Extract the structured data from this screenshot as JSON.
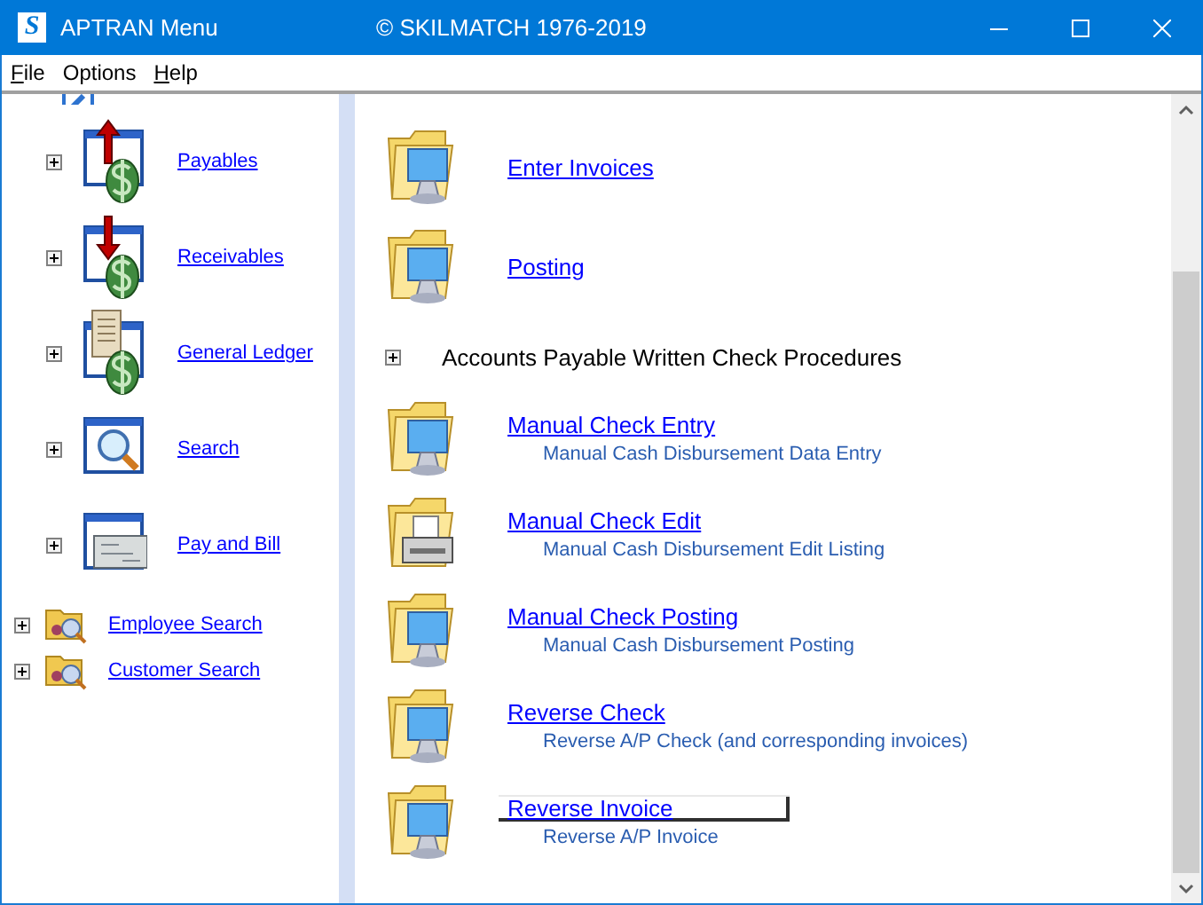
{
  "window": {
    "logo": "S",
    "title": "APTRAN Menu",
    "copyright": "© SKILMATCH 1976-2019"
  },
  "menu": [
    {
      "label": "File",
      "mnemonic": true
    },
    {
      "label": "Options",
      "mnemonic": false
    },
    {
      "label": "Help",
      "mnemonic": true
    }
  ],
  "sidebar": {
    "items": [
      {
        "kind": "large",
        "label": "Payables",
        "expanded": false
      },
      {
        "kind": "large",
        "label": "Receivables",
        "expanded": false
      },
      {
        "kind": "large",
        "label": "General Ledger",
        "expanded": false
      },
      {
        "kind": "large",
        "label": "Search",
        "expanded": false
      },
      {
        "kind": "large",
        "label": "Pay and Bill",
        "expanded": false
      },
      {
        "kind": "small",
        "label": "Employee Search",
        "expanded": false
      },
      {
        "kind": "small",
        "label": "Customer Search",
        "expanded": false
      }
    ]
  },
  "content": {
    "items": [
      {
        "kind": "program",
        "label": "Enter Invoices",
        "focused": false
      },
      {
        "kind": "program",
        "label": "Posting",
        "focused": false
      },
      {
        "kind": "group",
        "label": "Accounts Payable Written Check Procedures",
        "expanded": false
      },
      {
        "kind": "program",
        "label": "Manual Check Entry",
        "description": "Manual Cash Disbursement Data Entry",
        "focused": false
      },
      {
        "kind": "report",
        "label": "Manual Check Edit",
        "description": "Manual Cash Disbursement Edit Listing",
        "focused": false
      },
      {
        "kind": "program",
        "label": "Manual Check Posting",
        "description": "Manual Cash Disbursement Posting",
        "focused": false
      },
      {
        "kind": "program",
        "label": "Reverse Check",
        "description": "Reverse A/P Check (and corresponding invoices)",
        "focused": false
      },
      {
        "kind": "program",
        "label": "Reverse Invoice",
        "description": "Reverse A/P Invoice",
        "focused": true
      }
    ]
  }
}
